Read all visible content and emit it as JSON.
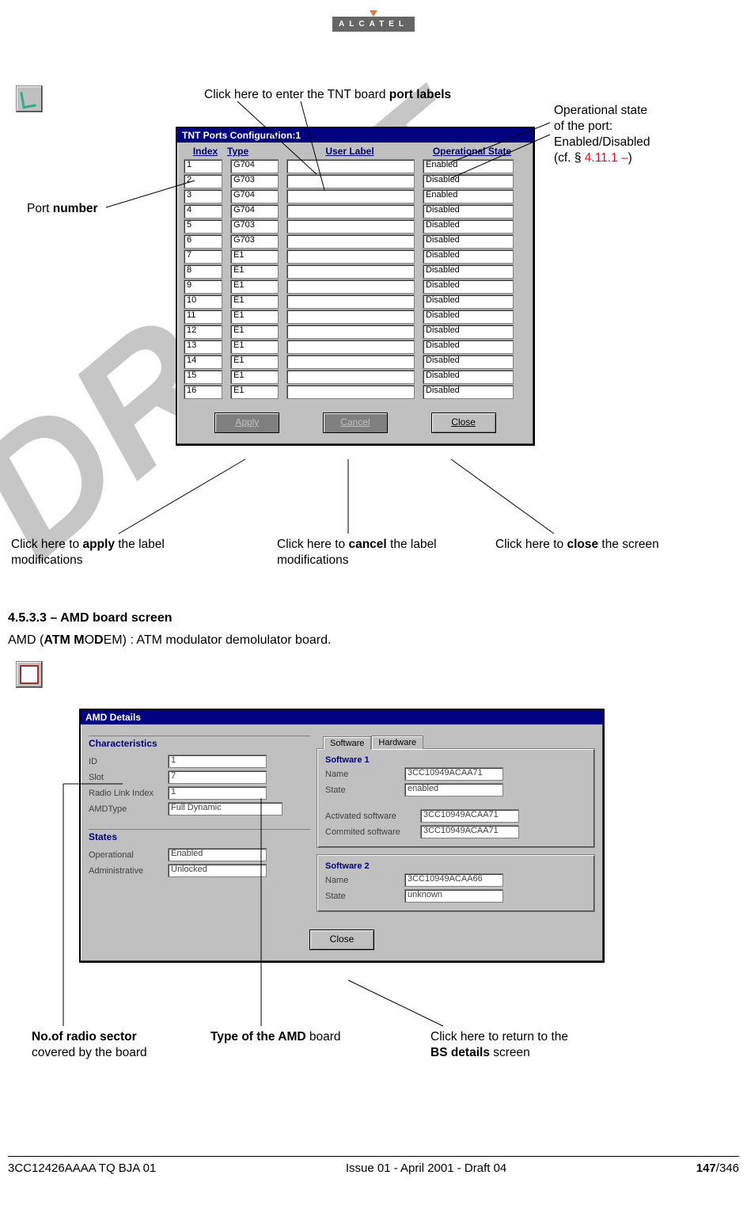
{
  "logo": {
    "text": "ALCATEL"
  },
  "callouts": {
    "port_labels": "Click here to enter the TNT board ",
    "port_labels_b": "port labels",
    "port_number_a": "Port ",
    "port_number_b": "number",
    "op_state_1": "Operational state",
    "op_state_2": "of the port:",
    "op_state_3": "Enabled/Disabled",
    "op_state_4a": "(cf. § ",
    "op_state_4b": "4.11.1 –",
    "op_state_4c": ")",
    "apply_a": "Click here to ",
    "apply_b": "apply",
    "apply_c": " the label",
    "apply_d": "modifications",
    "cancel_a": "Click here to ",
    "cancel_b": "cancel",
    "cancel_c": " the label",
    "cancel_d": "modifications",
    "close_a": "Click here to ",
    "close_b": "close",
    "close_c": " the screen",
    "radio_a": "No.of radio sector",
    "radio_b": "covered by the board",
    "amd_type_a": "Type of the AMD",
    "amd_type_b": " board",
    "bs_a": "Click here to return to the",
    "bs_b": "BS details",
    "bs_c": " screen"
  },
  "tnt": {
    "title": "TNT Ports Configuration:1",
    "head": {
      "index": "Index",
      "type": "Type",
      "label": "User Label",
      "state": "Operational State"
    },
    "rows": [
      {
        "index": "1",
        "type": "G704",
        "state": "Enabled"
      },
      {
        "index": "2",
        "type": "G703",
        "state": "Disabled"
      },
      {
        "index": "3",
        "type": "G704",
        "state": "Enabled"
      },
      {
        "index": "4",
        "type": "G704",
        "state": "Disabled"
      },
      {
        "index": "5",
        "type": "G703",
        "state": "Disabled"
      },
      {
        "index": "6",
        "type": "G703",
        "state": "Disabled"
      },
      {
        "index": "7",
        "type": "E1",
        "state": "Disabled"
      },
      {
        "index": "8",
        "type": "E1",
        "state": "Disabled"
      },
      {
        "index": "9",
        "type": "E1",
        "state": "Disabled"
      },
      {
        "index": "10",
        "type": "E1",
        "state": "Disabled"
      },
      {
        "index": "11",
        "type": "E1",
        "state": "Disabled"
      },
      {
        "index": "12",
        "type": "E1",
        "state": "Disabled"
      },
      {
        "index": "13",
        "type": "E1",
        "state": "Disabled"
      },
      {
        "index": "14",
        "type": "E1",
        "state": "Disabled"
      },
      {
        "index": "15",
        "type": "E1",
        "state": "Disabled"
      },
      {
        "index": "16",
        "type": "E1",
        "state": "Disabled"
      }
    ],
    "buttons": {
      "apply": "Apply",
      "cancel": "Cancel",
      "close": "Close"
    }
  },
  "watermark": "DRAFT",
  "section": {
    "num": "4.5.3.3 – ",
    "title": "AMD board screen",
    "para_a": "AMD (",
    "para_b": "ATM M",
    "para_c": "O",
    "para_d": "D",
    "para_e": "EM) : ATM modulator demolulator board."
  },
  "amd": {
    "title": "AMD Details",
    "groups": {
      "char": {
        "title": "Characteristics",
        "id_l": "ID",
        "id_v": "1",
        "slot_l": "Slot",
        "slot_v": "7",
        "rli_l": "Radio Link Index",
        "rli_v": "1",
        "type_l": "AMDType",
        "type_v": "Full Dynamic"
      },
      "states": {
        "title": "States",
        "op_l": "Operational",
        "op_v": "Enabled",
        "adm_l": "Administrative",
        "adm_v": "Unlocked"
      }
    },
    "tabs": {
      "sw": "Software",
      "hw": "Hardware"
    },
    "sw1": {
      "title": "Software 1",
      "name_l": "Name",
      "name_v": "3CC10949ACAA71",
      "state_l": "State",
      "state_v": "enabled",
      "act_l": "Activated software",
      "act_v": "3CC10949ACAA71",
      "com_l": "Commited software",
      "com_v": "3CC10949ACAA71"
    },
    "sw2": {
      "title": "Software 2",
      "name_l": "Name",
      "name_v": "3CC10949ACAA66",
      "state_l": "State",
      "state_v": "unknown"
    },
    "close": "Close"
  },
  "footer": {
    "left": "3CC12426AAAA TQ BJA 01",
    "center": "Issue 01 - April 2001 - Draft 04",
    "right_a": "147",
    "right_b": "/346"
  }
}
